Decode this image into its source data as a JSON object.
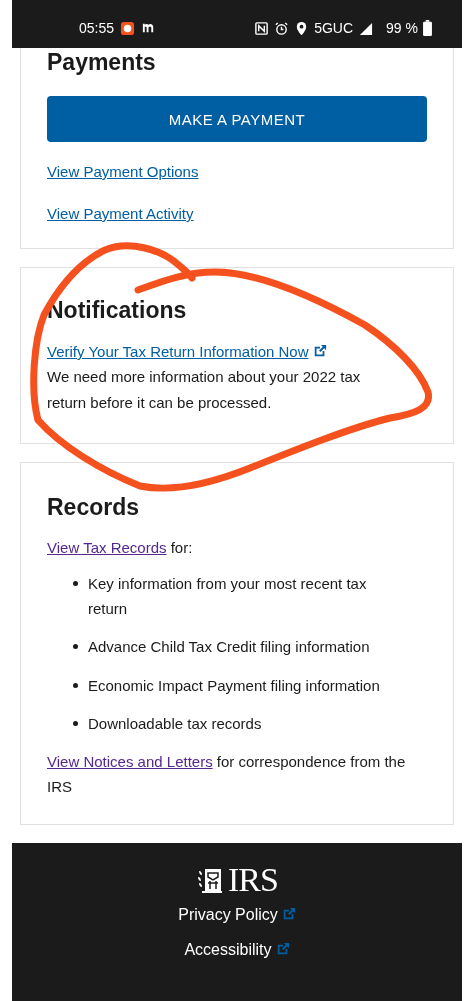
{
  "status_bar": {
    "time": "05:55",
    "network": "5GUC",
    "battery": "99 %"
  },
  "payments": {
    "heading": "Payments",
    "button": "MAKE A PAYMENT",
    "links": [
      {
        "text": "View Payment Options",
        "visited": false
      },
      {
        "text": "View Payment Activity",
        "visited": false
      }
    ]
  },
  "notifications": {
    "heading": "Notifications",
    "items": [
      {
        "link": "Verify Your Tax Return Information Now",
        "external": true,
        "message": "We need more information about your 2022 tax return before it can be processed."
      }
    ]
  },
  "records": {
    "heading": "Records",
    "intro": {
      "link": "View Tax Records",
      "visited": true,
      "text": "for:"
    },
    "items": [
      "Key information from your most recent tax return",
      "Advance Child Tax Credit filing information",
      "Economic Impact Payment filing information",
      "Downloadable tax records"
    ],
    "outro": {
      "link": "View Notices and Letters",
      "visited": true,
      "text": "for correspondence from the IRS"
    }
  },
  "footer": {
    "logo": "IRS",
    "links": [
      {
        "text": "Privacy Policy",
        "external": true
      },
      {
        "text": "Accessibility",
        "external": true
      }
    ]
  }
}
